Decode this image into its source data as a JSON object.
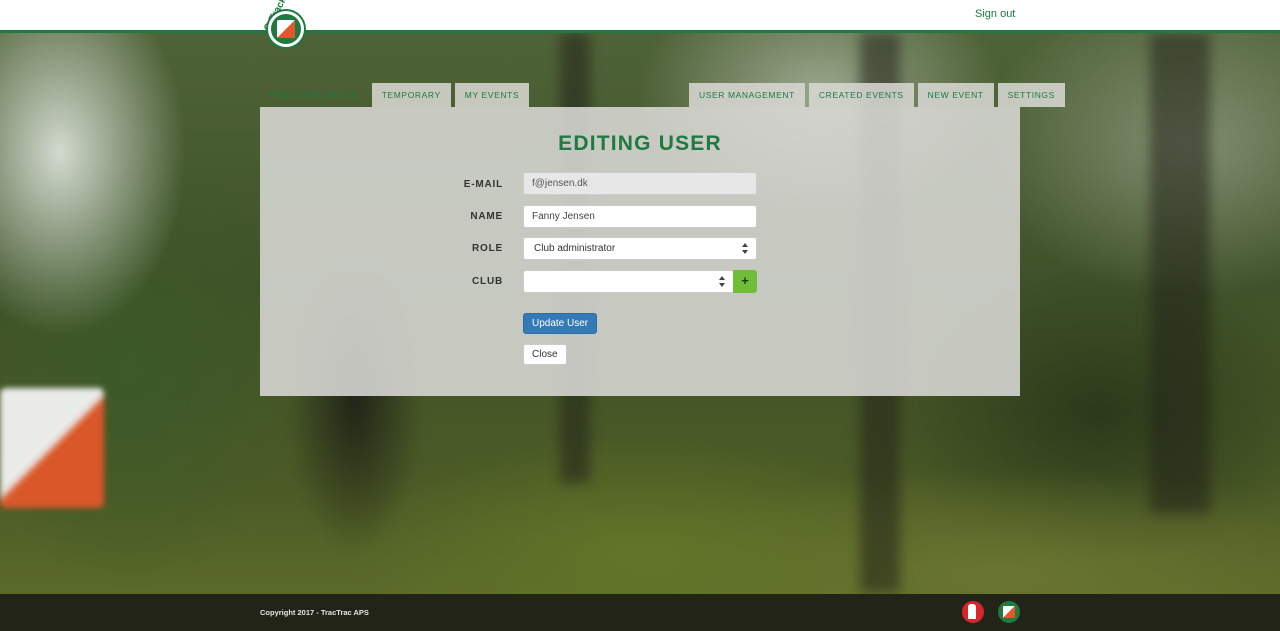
{
  "header": {
    "logo_text": "O-Track",
    "signout_label": "Sign out"
  },
  "tabs_left": [
    {
      "label": "FIND YOUR WAY IN",
      "active": true
    },
    {
      "label": "TEMPORARY",
      "active": false
    },
    {
      "label": "MY EVENTS",
      "active": false
    }
  ],
  "tabs_right": [
    {
      "label": "USER MANAGEMENT"
    },
    {
      "label": "CREATED EVENTS"
    },
    {
      "label": "NEW EVENT"
    },
    {
      "label": "SETTINGS"
    }
  ],
  "form": {
    "title": "EDITING USER",
    "email_label": "E-MAIL",
    "email_value": "f@jensen.dk",
    "name_label": "NAME",
    "name_value": "Fanny Jensen",
    "role_label": "ROLE",
    "role_value": "Club administrator",
    "club_label": "CLUB",
    "club_value": "",
    "add_club_label": "+",
    "update_label": "Update User",
    "close_label": "Close"
  },
  "footer": {
    "copyright": "Copyright 2017 - TracTrac APS"
  },
  "colors": {
    "brand_green": "#1e7a40",
    "accent_orange": "#e2572a",
    "primary_blue": "#337ab7",
    "add_green": "#6fbe3a"
  }
}
